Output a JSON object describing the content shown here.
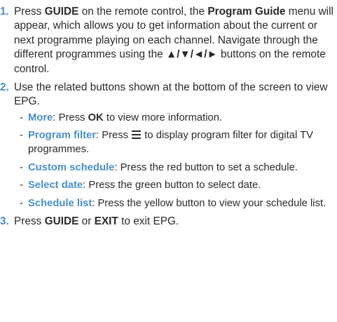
{
  "steps": [
    {
      "num": "1.",
      "t1": "Press ",
      "b1": "GUIDE",
      "t2": " on the remote control, the ",
      "b2": "Program Guide",
      "t3": " menu will appear, which allows you to get information about the current or next programme playing on each channel. Navigate through the different programmes using the ",
      "arrows": "▲/▼/◄/►",
      "t4": " buttons on the remote control."
    },
    {
      "num": "2.",
      "text": "Use the related buttons shown at the bottom of the screen to view EPG.",
      "sub": [
        {
          "term": "More",
          "t1": ": Press ",
          "b1": "OK",
          "t2": " to view more information."
        },
        {
          "term": "Program filter",
          "t1": ": Press ",
          "icon": "menu-icon",
          "t2": " to display program filter for digital TV programmes."
        },
        {
          "term": "Custom schedule",
          "t1": ": Press the red button to set a schedule."
        },
        {
          "term": "Select date",
          "t1": ": Press the green button to select date."
        },
        {
          "term": "Schedule list",
          "t1": ": Press the yellow button to view your schedule list."
        }
      ]
    },
    {
      "num": "3.",
      "t1": "Press ",
      "b1": "GUIDE",
      "t2": " or ",
      "b2": "EXIT",
      "t3": " to exit EPG."
    }
  ],
  "colors": {
    "accent": "#4a8fc8",
    "text": "#2b2b2b",
    "background": "#ffffff"
  }
}
